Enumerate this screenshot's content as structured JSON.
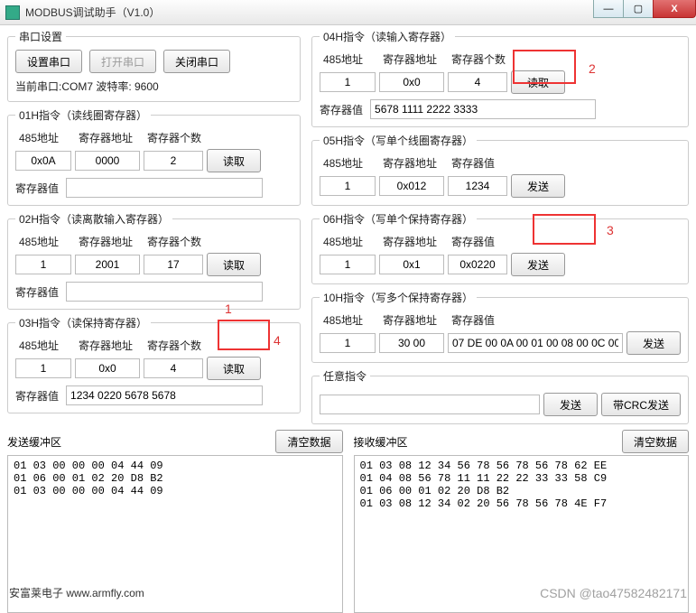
{
  "window": {
    "title": "MODBUS调试助手（V1.0）",
    "min": "—",
    "max": "▢",
    "close": "X"
  },
  "serial": {
    "legend": "串口设置",
    "btn_set": "设置串口",
    "btn_open": "打开串口",
    "btn_close": "关闭串口",
    "status": "当前串口:COM7 波特率: 9600"
  },
  "labels": {
    "addr": "485地址",
    "regaddr": "寄存器地址",
    "regcount": "寄存器个数",
    "regval": "寄存器值",
    "read": "读取",
    "send": "发送",
    "sendcrc": "带CRC发送",
    "clear": "清空数据"
  },
  "cmd01": {
    "legend": "01H指令（读线圈寄存器）",
    "addr": "0x0A",
    "regaddr": "0000",
    "regcount": "2",
    "regval": ""
  },
  "cmd02": {
    "legend": "02H指令（读离散输入寄存器）",
    "addr": "1",
    "regaddr": "2001",
    "regcount": "17",
    "regval": ""
  },
  "cmd03": {
    "legend": "03H指令（读保持寄存器）",
    "addr": "1",
    "regaddr": "0x0",
    "regcount": "4",
    "regval": "1234 0220 5678 5678"
  },
  "cmd04": {
    "legend": "04H指令（读输入寄存器）",
    "addr": "1",
    "regaddr": "0x0",
    "regcount": "4",
    "regval": "5678 1111 2222 3333"
  },
  "cmd05": {
    "legend": "05H指令（写单个线圈寄存器）",
    "addr": "1",
    "regaddr": "0x012",
    "regval": "1234"
  },
  "cmd06": {
    "legend": "06H指令（写单个保持寄存器）",
    "addr": "1",
    "regaddr": "0x1",
    "regval": "0x0220"
  },
  "cmd10": {
    "legend": "10H指令（写多个保持寄存器）",
    "addr": "1",
    "regaddr": "30 00",
    "regval": "07 DE 00 0A 00 01 00 08 00 0C 00"
  },
  "anycmd": {
    "legend": "任意指令",
    "value": ""
  },
  "txbuf": {
    "label": "发送缓冲区",
    "data": "01 03 00 00 00 04 44 09\n01 06 00 01 02 20 D8 B2\n01 03 00 00 00 04 44 09"
  },
  "rxbuf": {
    "label": "接收缓冲区",
    "data": "01 03 08 12 34 56 78 56 78 56 78 62 EE\n01 04 08 56 78 11 11 22 22 33 33 58 C9\n01 06 00 01 02 20 D8 B2\n01 03 08 12 34 02 20 56 78 56 78 4E F7"
  },
  "footer": "安富莱电子 www.armfly.com",
  "watermark": "CSDN @tao47582482171",
  "anno": {
    "n1": "1",
    "n2": "2",
    "n3": "3",
    "n4": "4"
  }
}
